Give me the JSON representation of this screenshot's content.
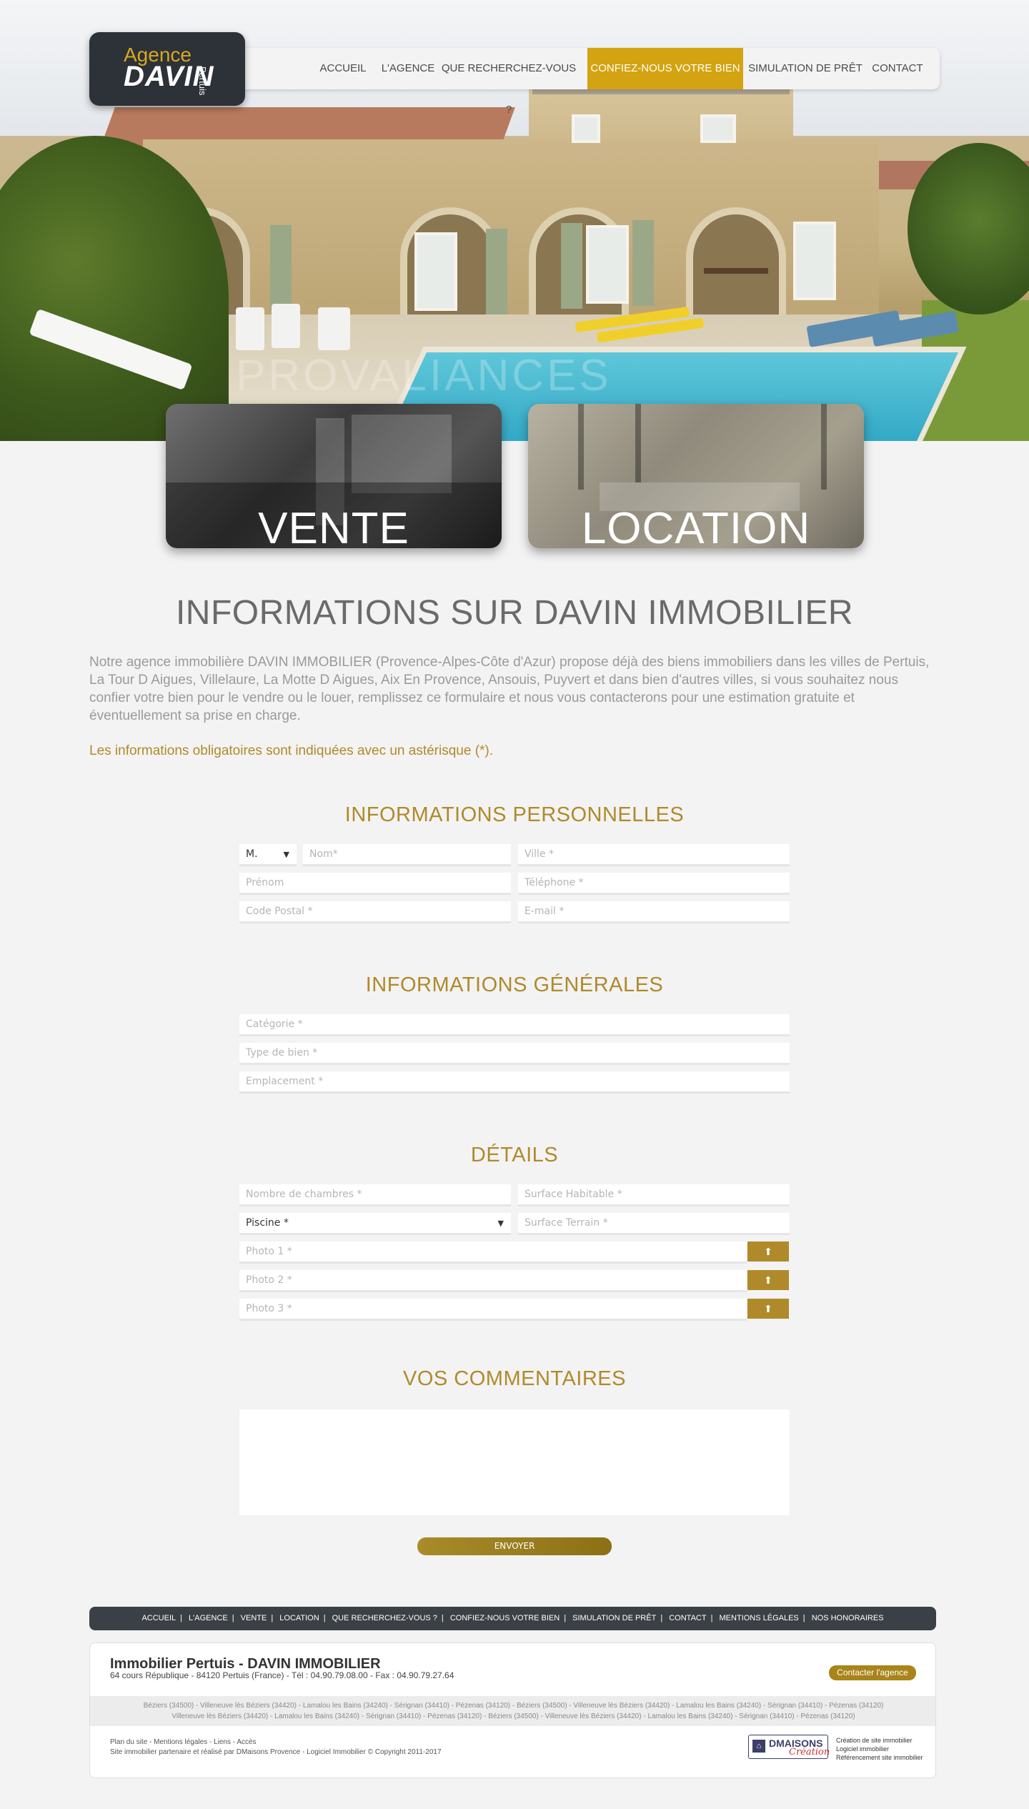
{
  "header": {
    "logo": {
      "line1": "Agence",
      "line2": "DAVIN",
      "side": "Pertuis"
    },
    "nav": [
      {
        "label": "ACCUEIL"
      },
      {
        "label": "L'AGENCE"
      },
      {
        "label": "QUE RECHERCHEZ-VOUS ?"
      },
      {
        "label": "CONFIEZ-NOUS VOTRE BIEN",
        "active": true
      },
      {
        "label": "SIMULATION DE PRÊT"
      },
      {
        "label": "CONTACT"
      }
    ]
  },
  "hero": {
    "watermark": "PROVALIANCES"
  },
  "cards": [
    {
      "label": "VENTE"
    },
    {
      "label": "LOCATION"
    }
  ],
  "main": {
    "title": "INFORMATIONS SUR DAVIN IMMOBILIER",
    "intro": "Notre agence immobilière DAVIN IMMOBILIER (Provence-Alpes-Côte d'Azur) propose déjà des biens immobiliers dans les villes de Pertuis, La Tour D Aigues, Villelaure, La Motte D Aigues, Aix En Provence, Ansouis, Puyvert et dans bien d'autres villes, si vous souhaitez nous confier votre bien pour le vendre ou le louer, remplissez ce formulaire et nous vous contacterons pour une estimation gratuite et éventuellement sa prise en charge.",
    "required_note": "Les informations obligatoires sont indiquées avec un astérisque (*)."
  },
  "sections": {
    "personal": {
      "title": "INFORMATIONS PERSONNELLES",
      "civility": "M.",
      "nom": "Nom*",
      "ville": "Ville *",
      "prenom": "Prénom",
      "telephone": "Téléphone *",
      "code_postal": "Code Postal *",
      "email": "E-mail *"
    },
    "general": {
      "title": "INFORMATIONS GÉNÉRALES",
      "categorie": "Catégorie *",
      "type_bien": "Type de bien *",
      "emplacement": "Emplacement *"
    },
    "details": {
      "title": "DÉTAILS",
      "chambres": "Nombre de chambres *",
      "surface_habitable": "Surface Habitable *",
      "piscine": "Piscine *",
      "surface_terrain": "Surface Terrain *",
      "photo1": "Photo 1 *",
      "photo2": "Photo 2 *",
      "photo3": "Photo 3 *",
      "upload_icon": "upload-icon"
    },
    "comments": {
      "title": "VOS COMMENTAIRES"
    }
  },
  "submit_label": "ENVOYER",
  "footer": {
    "nav": [
      "ACCUEIL",
      "L'AGENCE",
      "VENTE",
      "LOCATION",
      "QUE RECHERCHEZ-VOUS ?",
      "CONFIEZ-NOUS VOTRE BIEN",
      "SIMULATION DE PRÊT",
      "CONTACT",
      "MENTIONS LÉGALES",
      "NOS HONORAIRES"
    ],
    "company": "Immobilier Pertuis - DAVIN IMMOBILIER",
    "address": "64 cours République - 84120 Pertuis (France) - Tél : 04.90.79.08.00 - Fax : 04.90.79.27.64",
    "contact_button": "Contacter l'agence",
    "cities_line1": "Béziers (34500) - Villeneuve lès Béziers (34420) - Lamalou les Bains (34240) - Sérignan (34410) - Pézenas (34120) - Béziers (34500) - Villeneuve lès Béziers (34420) - Lamalou les Bains (34240) - Sérignan (34410) - Pézenas (34120)",
    "cities_line2": "Villeneuve lès Béziers (34420) - Lamalou les Bains (34240) - Sérignan (34410) - Pézenas (34120) - Béziers (34500) - Villeneuve lès Béziers (34420) - Lamalou les Bains (34240) - Sérignan (34410) - Pézenas (34120)",
    "links_line1": "Plan du site - Mentions légales - Liens - Accès",
    "links_line2": "Site immobilier partenaire et réalisé par DMaisons Provence - Logiciel Immobilier © Copyright 2011-2017",
    "dm_logo_main": "DMAISONS",
    "dm_logo_sub": "Création",
    "services": [
      "Création de site immobilier",
      "Logiciel immobilier",
      "Référencement site immobilier"
    ]
  },
  "colors": {
    "accent": "#d4a311",
    "gold_text": "#b08a2a",
    "dark": "#3b3f46"
  }
}
